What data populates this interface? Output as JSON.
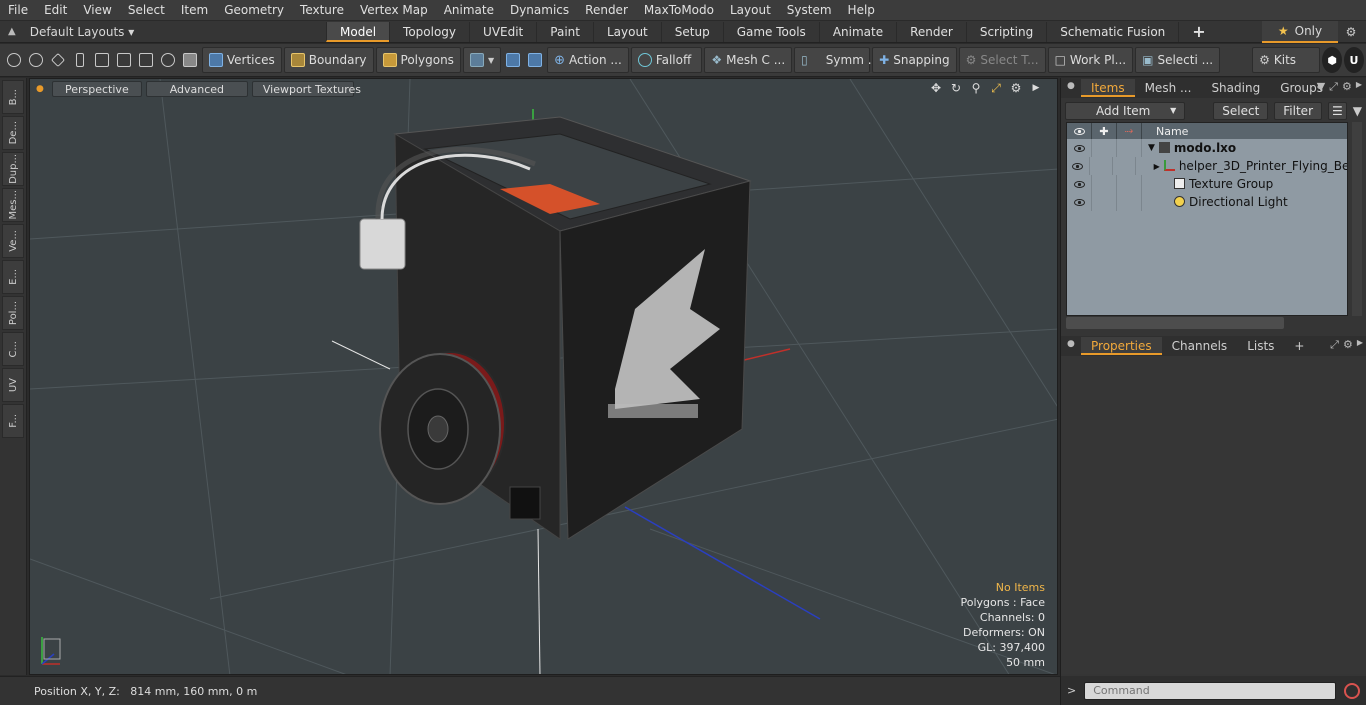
{
  "menu": [
    "File",
    "Edit",
    "View",
    "Select",
    "Item",
    "Geometry",
    "Texture",
    "Vertex Map",
    "Animate",
    "Dynamics",
    "Render",
    "MaxToModo",
    "Layout",
    "System",
    "Help"
  ],
  "layout_selector": "Default Layouts ▾",
  "tabs": [
    {
      "label": "Model",
      "active": true
    },
    {
      "label": "Topology"
    },
    {
      "label": "UVEdit"
    },
    {
      "label": "Paint"
    },
    {
      "label": "Layout"
    },
    {
      "label": "Setup"
    },
    {
      "label": "Game Tools"
    },
    {
      "label": "Animate"
    },
    {
      "label": "Render"
    },
    {
      "label": "Scripting"
    },
    {
      "label": "Schematic Fusion"
    }
  ],
  "tab_add": "+",
  "only_label": "Only",
  "toolbar": {
    "vertices": "Vertices",
    "boundary": "Boundary",
    "polygons": "Polygons",
    "action": "Action ...",
    "falloff": "Falloff",
    "mesh": "Mesh C ...",
    "symm": "Symm ...",
    "snapping": "Snapping",
    "select_t": "Select T...",
    "work_pl": "Work Pl...",
    "selecti": "Selecti ...",
    "kits": "Kits"
  },
  "left_tabs": [
    "B...",
    "De...",
    "Dup...",
    "Mes...",
    "Ve...",
    "E...",
    "Pol...",
    "C...",
    "UV",
    "F..."
  ],
  "viewport": {
    "perspective": "Perspective",
    "advanced": "Advanced",
    "textures": "Viewport Textures",
    "info": {
      "no_items": "No Items",
      "polygons": "Polygons : Face",
      "channels": "Channels: 0",
      "deformers": "Deformers: ON",
      "gl": "GL: 397,400",
      "scale": "50 mm"
    }
  },
  "status": "Position X, Y, Z:   814 mm, 160 mm, 0 m",
  "panel": {
    "tabs": [
      {
        "label": "Items",
        "active": true
      },
      {
        "label": "Mesh ..."
      },
      {
        "label": "Shading"
      },
      {
        "label": "Groups"
      }
    ],
    "add_item": "Add Item",
    "select": "Select",
    "filter": "Filter",
    "name_header": "Name",
    "tree": [
      {
        "label": "modo.lxo",
        "bold": true,
        "indent": 0
      },
      {
        "label": "helper_3D_Printer_Flying_Be ...",
        "indent": 1
      },
      {
        "label": "Texture Group",
        "indent": 1
      },
      {
        "label": "Directional Light",
        "indent": 1
      }
    ],
    "lower_tabs": [
      {
        "label": "Properties",
        "active": true
      },
      {
        "label": "Channels"
      },
      {
        "label": "Lists"
      }
    ],
    "lower_add": "+",
    "command_placeholder": "Command"
  },
  "colors": {
    "accent": "#e89a2a",
    "viewport_bg": "#3b4245",
    "warning_text": "#f0b64a"
  }
}
